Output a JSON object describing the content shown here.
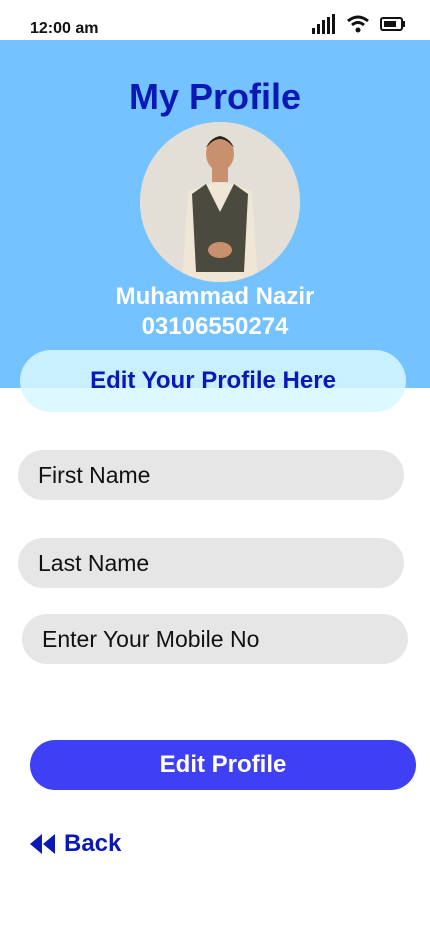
{
  "status": {
    "time": "12:00 am",
    "icons": [
      "signal-icon",
      "wifi-icon",
      "battery-icon"
    ]
  },
  "profile": {
    "title": "My Profile",
    "name": "Muhammad Nazir",
    "phone": "03106550274",
    "edit_banner": "Edit Your Profile Here"
  },
  "form": {
    "first_name_placeholder": "First Name",
    "last_name_placeholder": "Last Name",
    "mobile_placeholder": "Enter Your Mobile No"
  },
  "actions": {
    "edit_profile_label": "Edit Profile",
    "back_label": "Back",
    "back_icon": "rewind-icon"
  },
  "colors": {
    "header_bg": "#74c2ff",
    "title": "#0a18b5",
    "button": "#3f3ff5",
    "field_bg": "#e6e6e6"
  }
}
